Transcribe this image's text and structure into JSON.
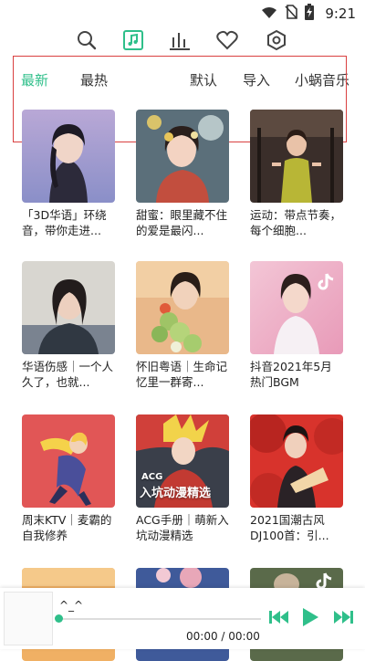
{
  "status_bar": {
    "time": "9:21",
    "icons": [
      "wifi-icon",
      "no-sim-icon",
      "battery-charging-icon"
    ]
  },
  "top_tabs": [
    {
      "icon": "search-icon"
    },
    {
      "icon": "music-note-icon",
      "active": true
    },
    {
      "icon": "chart-bars-icon"
    },
    {
      "icon": "heart-icon"
    },
    {
      "icon": "settings-icon"
    }
  ],
  "sub_tabs": [
    {
      "label": "最新",
      "active": true
    },
    {
      "label": "最热"
    },
    {
      "label": "默认"
    },
    {
      "label": "导入"
    },
    {
      "label": "小蜗音乐"
    }
  ],
  "playlists": [
    {
      "title": "「3D华语」环绕音，带你走进..."
    },
    {
      "title": "甜蜜：眼里藏不住的爱是最闪..."
    },
    {
      "title": "运动：带点节奏，每个细胞..."
    },
    {
      "title": "华语伤感｜一个人久了，也就..."
    },
    {
      "title": "怀旧粤语｜生命记忆里一群寄..."
    },
    {
      "title": "抖音2021年5月热门BGM"
    },
    {
      "title": "周末KTV｜麦霸的自我修养"
    },
    {
      "title": "ACG手册｜萌新入坑动漫精选",
      "overlay_small": "ACG",
      "overlay": "入坑动漫精选"
    },
    {
      "title": "2021国潮古风DJ100首：引..."
    },
    {
      "title": ""
    },
    {
      "title": ""
    },
    {
      "title": ""
    }
  ],
  "player": {
    "track": "^_^",
    "time": "00:00 / 00:00",
    "progress": 0,
    "controls": [
      "previous-icon",
      "play-icon",
      "next-icon"
    ]
  },
  "colors": {
    "accent": "#2fbf8a",
    "selection_box": "#d94040"
  }
}
